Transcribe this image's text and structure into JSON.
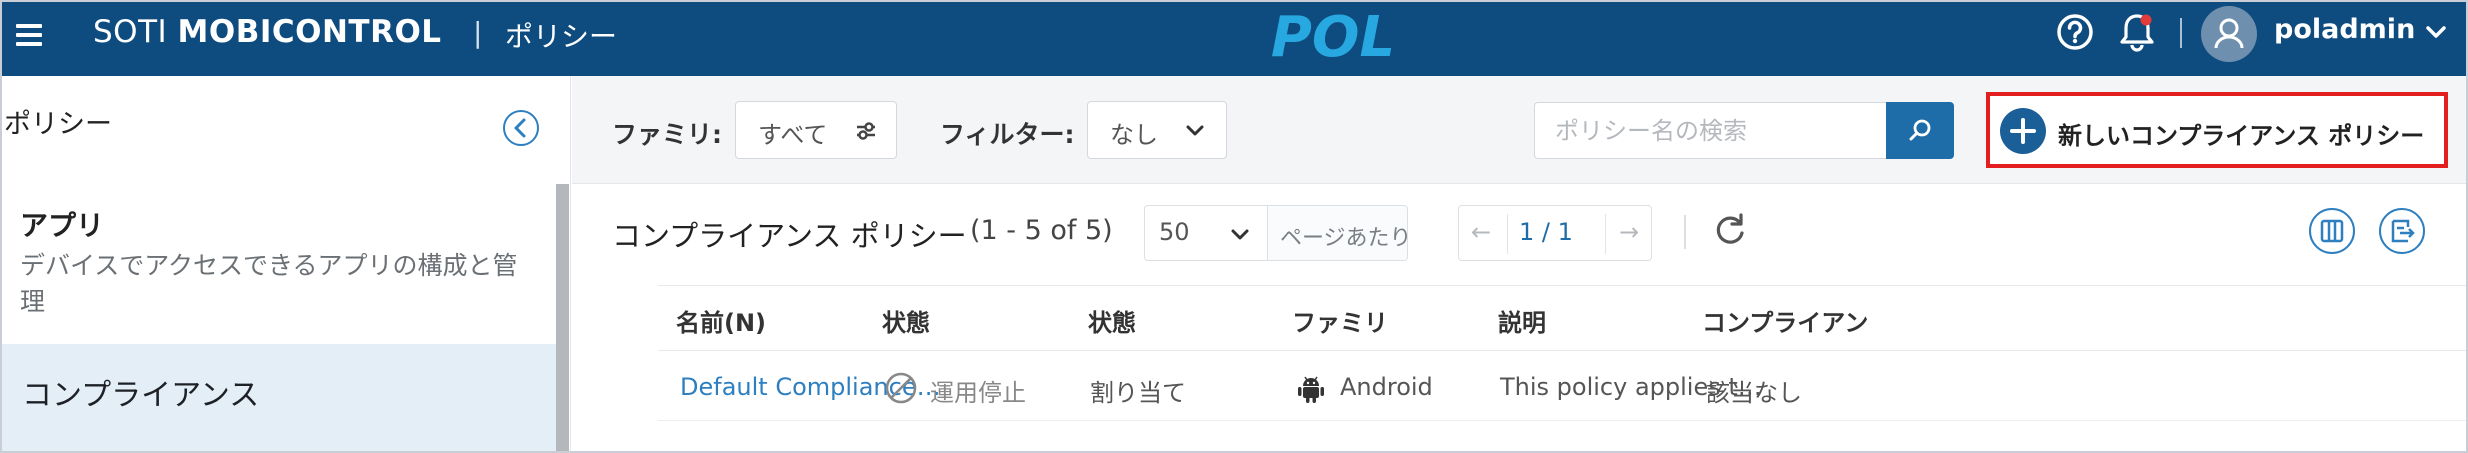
{
  "header": {
    "brand_light": "SOTI ",
    "brand_bold": "MOBICONTROL",
    "separator": "|",
    "page": "ポリシー",
    "logo_text": "POL",
    "username": "poladmin",
    "colors": {
      "bar": "#0e4c80",
      "logo": "#28a8e0",
      "notification_dot": "#e33b3b"
    }
  },
  "sidebar": {
    "title": "ポリシー",
    "items": [
      {
        "label": "アプリ",
        "description": "デバイスでアクセスできるアプリの構成と管理"
      },
      {
        "label": "コンプライアンス",
        "active": true
      }
    ]
  },
  "toolbar": {
    "family_label": "ファミリ:",
    "family_value": "すべて",
    "filter_label": "フィルター:",
    "filter_value": "なし",
    "search_placeholder": "ポリシー名の検索",
    "new_button": "新しいコンプライアンス ポリシー"
  },
  "list": {
    "title": "コンプライアンス ポリシー",
    "count": "(1 - 5 of 5)",
    "per_page": "50",
    "per_page_label": "ページあたり",
    "page": "1 / 1",
    "prev": "←",
    "next": "→"
  },
  "table": {
    "columns": [
      "名前(N)",
      "状態",
      "状態",
      "ファミリ",
      "説明",
      "コンプライアン"
    ],
    "rows": [
      {
        "name": "Default Compliance…",
        "status": "運用停止",
        "assignment": "割り当て",
        "family": "Android",
        "description": "This policy applies t…",
        "compliance": "該当なし"
      }
    ]
  },
  "icons": {
    "menu": "hamburger-icon",
    "help": "help-icon",
    "bell": "bell-icon",
    "user": "user-icon",
    "search": "search-icon",
    "refresh": "refresh-icon",
    "status": "prohibited-icon",
    "platform": "android-icon"
  }
}
